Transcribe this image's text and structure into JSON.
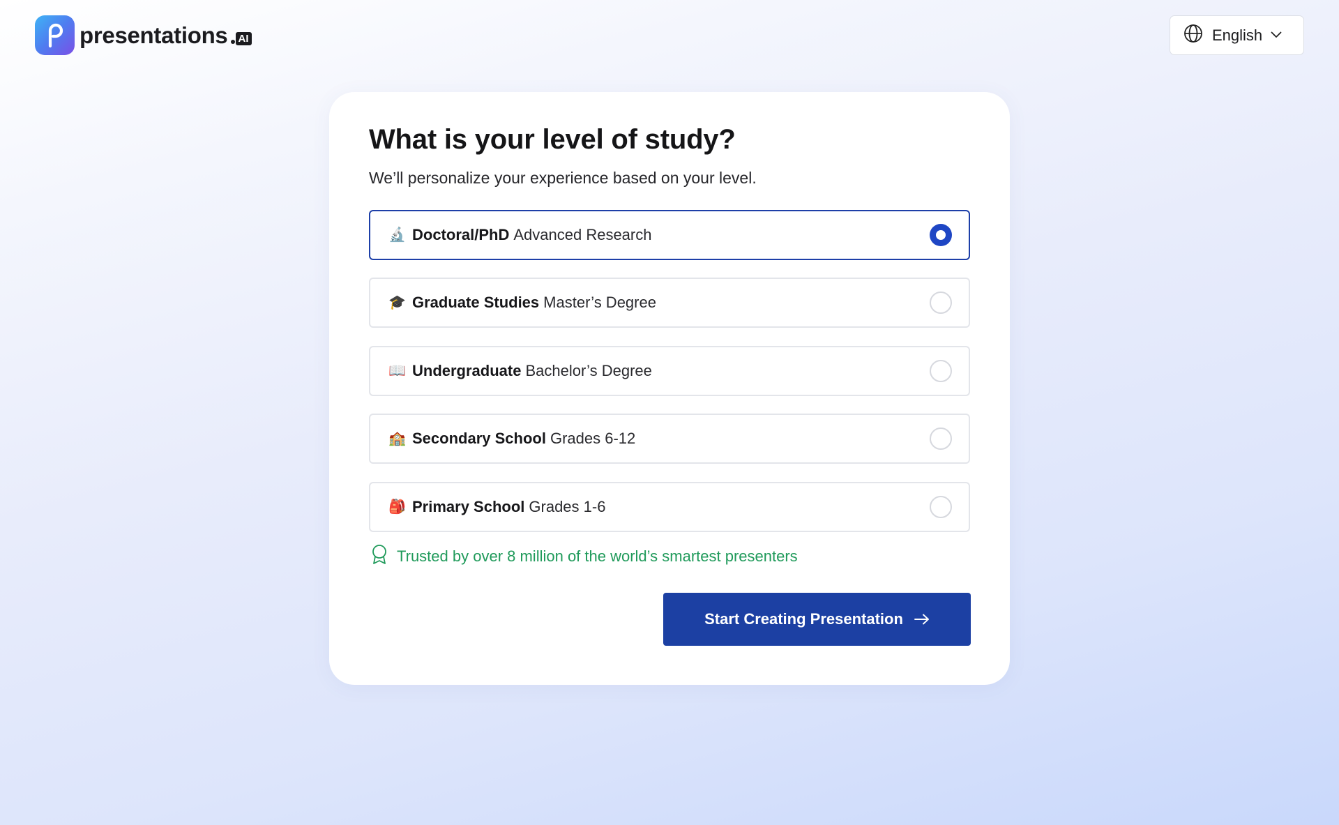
{
  "brand": {
    "name": "presentations",
    "suffix": "AI",
    "logo_icon": "p-logo-icon"
  },
  "language": {
    "icon": "globe-icon",
    "label": "English",
    "chevron": "chevron-down-icon"
  },
  "card": {
    "title": "What is your level of study?",
    "subtitle": "We’ll personalize your experience based on your level."
  },
  "options": [
    {
      "id": "doctoral",
      "icon": "🔬",
      "icon_name": "microscope-icon",
      "name": "Doctoral/PhD",
      "desc": "Advanced Research",
      "selected": true
    },
    {
      "id": "graduate",
      "icon": "🎓",
      "icon_name": "graduation-cap-icon",
      "name": "Graduate Studies",
      "desc": "Master’s Degree",
      "selected": false
    },
    {
      "id": "undergraduate",
      "icon": "📖",
      "icon_name": "open-book-icon",
      "name": "Undergraduate",
      "desc": "Bachelor’s Degree",
      "selected": false
    },
    {
      "id": "secondary",
      "icon": "🏫",
      "icon_name": "school-icon",
      "name": "Secondary School",
      "desc": "Grades 6-12",
      "selected": false
    },
    {
      "id": "primary",
      "icon": "🎒",
      "icon_name": "backpack-icon",
      "name": "Primary School",
      "desc": "Grades 1-6",
      "selected": false
    }
  ],
  "trust": {
    "icon": "award-badge-icon",
    "text": "Trusted by over 8 million of the world’s smartest presenters"
  },
  "cta": {
    "label": "Start Creating Presentation",
    "icon": "arrow-right-icon"
  },
  "colors": {
    "accent": "#1c40a3",
    "radio_selected": "#1e46c4",
    "trust_green": "#1f9a5a"
  }
}
